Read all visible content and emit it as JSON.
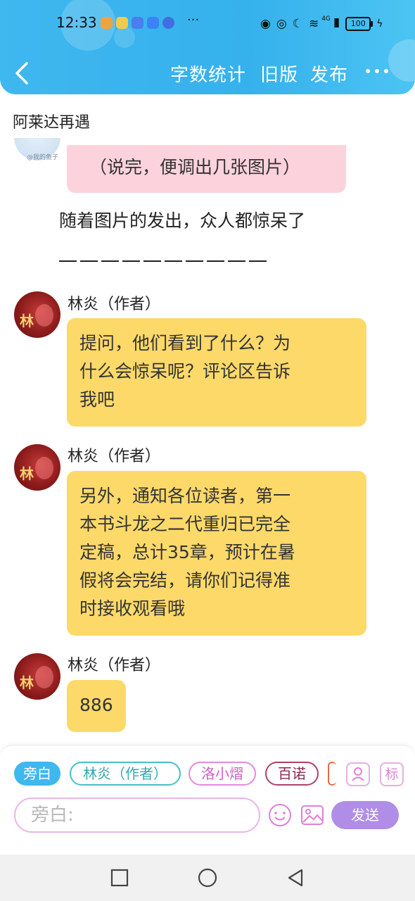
{
  "status_bar": {
    "time": "12:33",
    "more": "···",
    "network": "4G",
    "battery": "100",
    "app_colors": [
      "#f0a33b",
      "#f3c94a",
      "#4a7df0",
      "#3b82f6",
      "#3f6fe0"
    ]
  },
  "header": {
    "back_icon": "chevron-left-icon",
    "word_count": "字数统计",
    "old_version": "旧版",
    "publish": "发布",
    "more_icon": "more-dots-icon",
    "accent_color": "#3fb7ef"
  },
  "chapter_title": "阿莱达再遇",
  "partial_avatar_text": "@我的鱼子",
  "messages": [
    {
      "type": "bubble",
      "text": "（说完，便调出几张图片）"
    },
    {
      "type": "narration",
      "text": "随着图片的发出，众人都惊呆了"
    },
    {
      "type": "author",
      "name": "林炎（作者）",
      "lines": [
        "提问，他们看到了什么？为",
        "什么会惊呆呢？评论区告诉",
        "我吧"
      ]
    },
    {
      "type": "author",
      "name": "林炎（作者）",
      "lines": [
        "另外，通知各位读者，第一",
        "本书斗龙之二代重归已完全",
        "定稿，总计35章，预计在暑",
        "假将会完结，请你们记得准",
        "时接收观看哦"
      ]
    },
    {
      "type": "author",
      "name": "林炎（作者）",
      "lines": [
        "886"
      ]
    }
  ],
  "author_avatar": {
    "big_char": "林"
  },
  "roles": [
    {
      "label": "旁白",
      "active": true
    },
    {
      "label": "林炎（作者）",
      "active": false
    },
    {
      "label": "洛小熠",
      "active": false
    },
    {
      "label": "百诺",
      "active": false
    }
  ],
  "role_tools": {
    "tag_label": "标",
    "person_icon": "person-icon"
  },
  "input": {
    "placeholder": "旁白:"
  },
  "send_label": "发送",
  "icons": {
    "emoji": "smiley-icon",
    "image": "image-icon"
  },
  "colors": {
    "bubble_yellow": "#fdd96a",
    "bubble_pink": "#fcd3dd",
    "send_purple": "#b08de6"
  }
}
